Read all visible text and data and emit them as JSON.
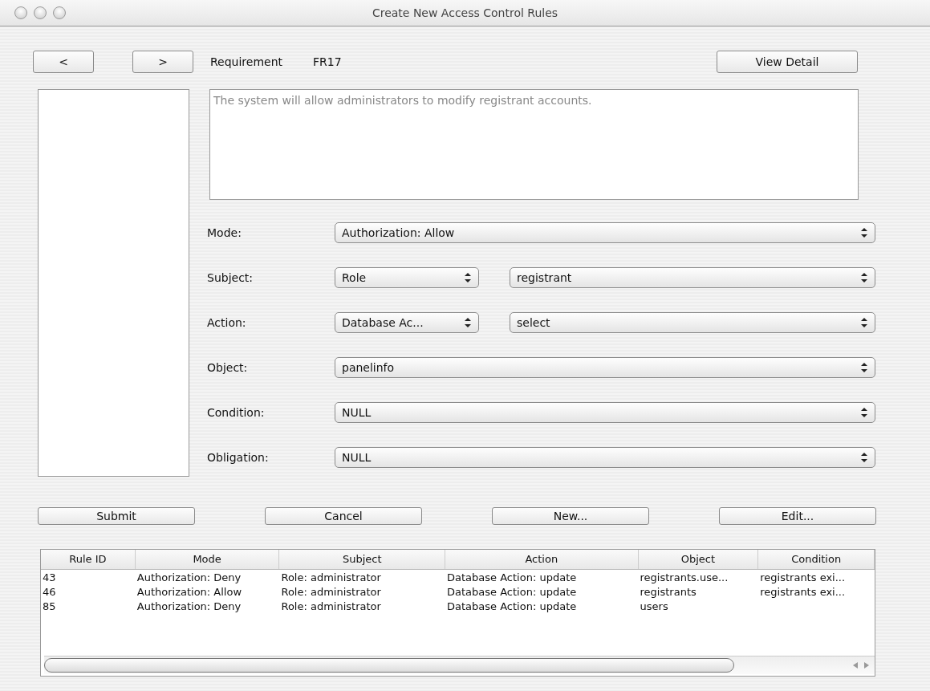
{
  "window": {
    "title": "Create New Access Control Rules"
  },
  "nav": {
    "prev": "<",
    "next": ">",
    "requirement_label": "Requirement",
    "requirement_id": "FR17",
    "view_detail": "View Detail"
  },
  "description": "The system will allow administrators to modify registrant accounts.",
  "form": [
    {
      "label": "Mode:",
      "selects": [
        "Authorization: Allow"
      ]
    },
    {
      "label": "Subject:",
      "selects": [
        "Role",
        "registrant"
      ]
    },
    {
      "label": "Action:",
      "selects": [
        "Database Ac...",
        "select"
      ]
    },
    {
      "label": "Object:",
      "selects": [
        "panelinfo"
      ]
    },
    {
      "label": "Condition:",
      "selects": [
        "NULL"
      ]
    },
    {
      "label": "Obligation:",
      "selects": [
        "NULL"
      ]
    }
  ],
  "buttons": [
    "Submit",
    "Cancel",
    "New...",
    "Edit..."
  ],
  "table": {
    "columns": [
      "Rule ID",
      "Mode",
      "Subject",
      "Action",
      "Object",
      "Condition"
    ],
    "rows": [
      [
        "43",
        "Authorization: Deny",
        "Role: administrator",
        "Database Action: update",
        "registrants.use...",
        "registrants exi..."
      ],
      [
        "46",
        "Authorization: Allow",
        "Role: administrator",
        "Database Action: update",
        "registrants",
        "registrants exi..."
      ],
      [
        "85",
        "Authorization: Deny",
        "Role: administrator",
        "Database Action: update",
        "users",
        ""
      ]
    ]
  }
}
